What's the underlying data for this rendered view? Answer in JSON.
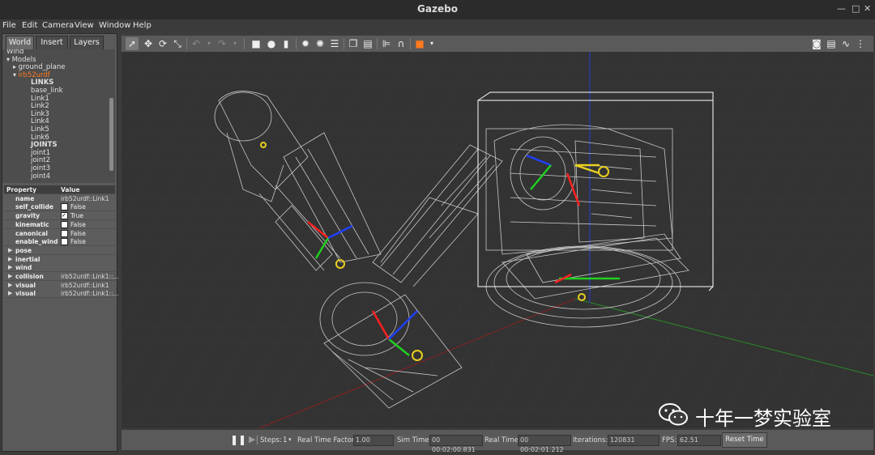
{
  "window": {
    "title": "Gazebo"
  },
  "menu": [
    "File",
    "Edit",
    "Camera",
    "View",
    "Window",
    "Help"
  ],
  "tabs": [
    "World",
    "Insert",
    "Layers"
  ],
  "tree": {
    "items": [
      {
        "label": "Wind",
        "indent": 0
      },
      {
        "label": "Models",
        "indent": 0,
        "arrow": "down"
      },
      {
        "label": "ground_plane",
        "indent": 1,
        "arrow": "right"
      },
      {
        "label": "irb52urdf",
        "indent": 1,
        "arrow": "down",
        "selected": true
      },
      {
        "label": "LINKS",
        "indent": 2,
        "bold": true
      },
      {
        "label": "base_link",
        "indent": 2
      },
      {
        "label": "Link1",
        "indent": 2
      },
      {
        "label": "Link2",
        "indent": 2
      },
      {
        "label": "Link3",
        "indent": 2
      },
      {
        "label": "Link4",
        "indent": 2
      },
      {
        "label": "Link5",
        "indent": 2
      },
      {
        "label": "Link6",
        "indent": 2
      },
      {
        "label": "JOINTS",
        "indent": 2,
        "bold": true
      },
      {
        "label": "joint1",
        "indent": 2
      },
      {
        "label": "joint2",
        "indent": 2
      },
      {
        "label": "joint3",
        "indent": 2
      },
      {
        "label": "joint4",
        "indent": 2
      }
    ]
  },
  "properties": {
    "header_property": "Property",
    "header_value": "Value",
    "rows": [
      {
        "key": "name",
        "value": "irb52urdf::Link1"
      },
      {
        "key": "self_collide",
        "checkbox": false,
        "value": "False"
      },
      {
        "key": "gravity",
        "checkbox": true,
        "value": "True"
      },
      {
        "key": "kinematic",
        "checkbox": false,
        "value": "False"
      },
      {
        "key": "canonical",
        "checkbox": false,
        "value": "False"
      },
      {
        "key": "enable_wind",
        "checkbox": false,
        "value": "False"
      }
    ],
    "sections": [
      {
        "key": "pose",
        "value": ""
      },
      {
        "key": "inertial",
        "value": ""
      },
      {
        "key": "wind",
        "value": ""
      },
      {
        "key": "collision",
        "value": "irb52urdf::Link1::..."
      },
      {
        "key": "visual",
        "value": "irb52urdf::Link1"
      },
      {
        "key": "visual",
        "value": "irb52urdf::Link1::..."
      }
    ]
  },
  "bottom": {
    "steps_label": "Steps:",
    "steps_value": "1",
    "rtf_label": "Real Time Factor:",
    "rtf_value": "1.00",
    "sim_label": "Sim Time:",
    "sim_value": "00 00:02:00.831",
    "real_label": "Real Time:",
    "real_value": "00 00:02:01.212",
    "iter_label": "Iterations:",
    "iter_value": "120831",
    "fps_label": "FPS:",
    "fps_value": "62.51",
    "reset_label": "Reset Time"
  },
  "watermark": "十年一梦实验室",
  "colors": {
    "x_axis": "#ff2020",
    "y_axis": "#20d020",
    "z_axis": "#2040ff",
    "bbox": "#ffffff",
    "wireframe": "#c8c8c8"
  }
}
